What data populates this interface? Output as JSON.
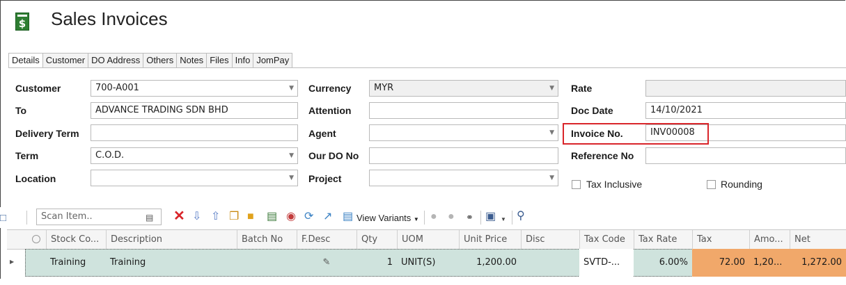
{
  "window": {
    "title": "Sales Invoices",
    "app_icon": "dollar-document-icon"
  },
  "tabs": [
    {
      "label": "Details",
      "active": true
    },
    {
      "label": "Customer"
    },
    {
      "label": "DO Address"
    },
    {
      "label": "Others"
    },
    {
      "label": "Notes"
    },
    {
      "label": "Files"
    },
    {
      "label": "Info"
    },
    {
      "label": "JomPay"
    }
  ],
  "form": {
    "customer": {
      "label": "Customer",
      "value": "700-A001"
    },
    "to": {
      "label": "To",
      "value": "ADVANCE TRADING SDN BHD"
    },
    "delivery_term": {
      "label": "Delivery Term",
      "value": ""
    },
    "term": {
      "label": "Term",
      "value": "C.O.D."
    },
    "location": {
      "label": "Location",
      "value": ""
    },
    "currency": {
      "label": "Currency",
      "value": "MYR"
    },
    "attention": {
      "label": "Attention",
      "value": ""
    },
    "agent": {
      "label": "Agent",
      "value": ""
    },
    "our_do_no": {
      "label": "Our DO No",
      "value": ""
    },
    "project": {
      "label": "Project",
      "value": ""
    },
    "rate": {
      "label": "Rate",
      "value": ""
    },
    "doc_date": {
      "label": "Doc Date",
      "value": "14/10/2021"
    },
    "invoice_no": {
      "label": "Invoice No.",
      "value": "INV00008"
    },
    "reference_no": {
      "label": "Reference No",
      "value": ""
    },
    "tax_inclusive": {
      "label": "Tax Inclusive",
      "checked": false
    },
    "rounding": {
      "label": "Rounding",
      "checked": false
    }
  },
  "toolbar": {
    "scan_placeholder": "Scan Item..",
    "view_variants": "View Variants"
  },
  "grid": {
    "columns": [
      "Stock Co...",
      "Description",
      "Batch No",
      "F.Desc",
      "Qty",
      "UOM",
      "Unit Price",
      "Disc",
      "Tax Code",
      "Tax Rate",
      "Tax",
      "Amo...",
      "Net"
    ],
    "rows": [
      {
        "stock_code": "Training",
        "description": "Training",
        "batch_no": "",
        "qty": "1",
        "uom": "UNIT(S)",
        "unit_price": "1,200.00",
        "disc": "",
        "tax_code": "SVTD-...",
        "tax_rate": "6.00%",
        "tax": "72.00",
        "amount": "1,20...",
        "net": "1,272.00"
      }
    ]
  },
  "colors": {
    "highlight": "#d9252a",
    "row_bg": "#cfe3dd",
    "tax_cells": "#f1a86a"
  }
}
